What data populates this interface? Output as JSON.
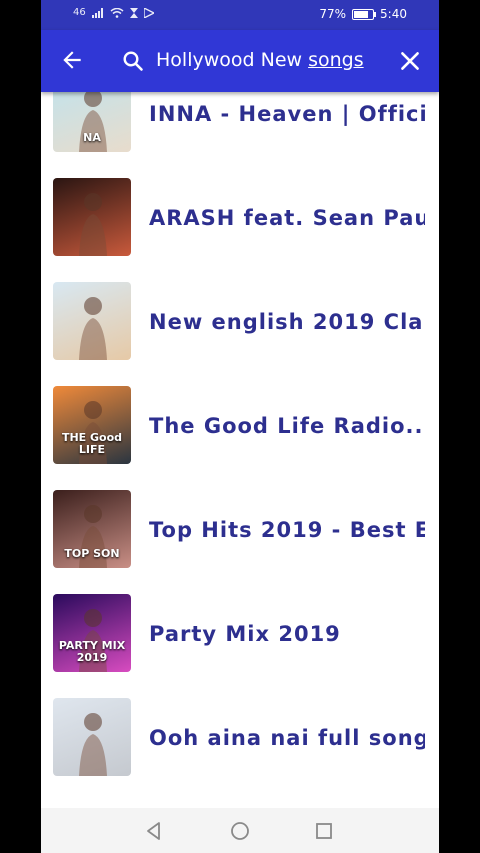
{
  "status_bar": {
    "network_label": "46",
    "battery_percent": "77%",
    "battery_level": 0.77,
    "time": "5:40"
  },
  "toolbar": {
    "search_query_prefix": "Hollywood New ",
    "search_query_underlined": "songs",
    "back_icon": "arrow-left-icon",
    "search_icon": "search-icon",
    "clear_icon": "close-icon",
    "color": "#3037d6"
  },
  "results": [
    {
      "title": "INNA - Heaven | Offici..",
      "thumb_colors": [
        "#bfe3ee",
        "#e8dccc"
      ],
      "thumb_label": "NA"
    },
    {
      "title": "ARASH feat. Sean Pau..",
      "thumb_colors": [
        "#2a1512",
        "#c95a3c"
      ],
      "thumb_label": ""
    },
    {
      "title": "New english 2019 Cla..",
      "thumb_colors": [
        "#d8e8f2",
        "#e6c9a6"
      ],
      "thumb_label": ""
    },
    {
      "title": "The Good Life Radio..",
      "thumb_colors": [
        "#f08a3a",
        "#2a3540"
      ],
      "thumb_label": "THE Good LIFE"
    },
    {
      "title": "Top Hits 2019 - Best E..",
      "thumb_colors": [
        "#3b1f1c",
        "#c98f86"
      ],
      "thumb_label": "TOP SON"
    },
    {
      "title": "Party Mix 2019",
      "thumb_colors": [
        "#2a0a5c",
        "#d84cc0"
      ],
      "thumb_label": "PARTY MIX 2019"
    },
    {
      "title": "Ooh aina nai full song",
      "thumb_colors": [
        "#dfe6ee",
        "#c5c9cf"
      ],
      "thumb_label": ""
    }
  ],
  "title_color": "#2d2f8f",
  "nav_bar": {
    "back_icon": "triangle-back-icon",
    "home_icon": "circle-home-icon",
    "recents_icon": "square-recents-icon"
  }
}
